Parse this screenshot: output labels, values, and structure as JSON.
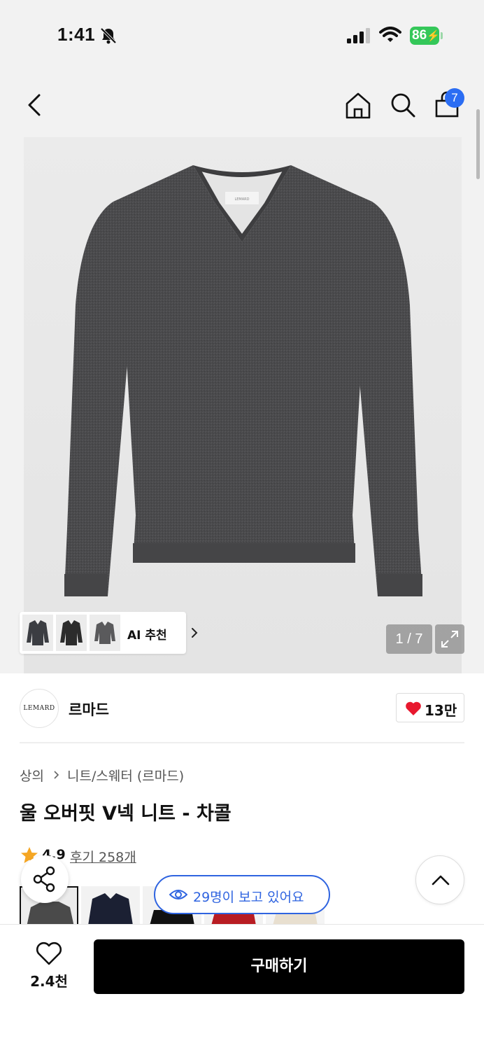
{
  "status_bar": {
    "time": "1:41",
    "battery": "86",
    "icons": [
      "bell-off-icon",
      "signal-icon",
      "wifi-icon",
      "battery-charging-icon"
    ]
  },
  "nav": {
    "icons": [
      "back-icon",
      "home-icon",
      "search-icon",
      "cart-icon"
    ],
    "cart_count": "7"
  },
  "gallery": {
    "counter": "1 / 7",
    "ai_label": "AI 추천",
    "brand_tag": "LEMARD"
  },
  "brand": {
    "logo_text": "LEMARD",
    "name": "르마드",
    "like_count": "13만"
  },
  "product": {
    "breadcrumb": [
      "상의",
      "니트/스웨터 (르마드)"
    ],
    "title": "울 오버핏 V넥 니트 - 차콜",
    "rating": "4.9",
    "reviews": "후기 258개"
  },
  "colors": {
    "swatches": [
      "#4a4a4a",
      "#1b2033",
      "#111111",
      "#b81c22",
      "#e8dfcf"
    ]
  },
  "viewers_text": "29명이 보고 있어요",
  "bottom": {
    "wish_count": "2.4천",
    "buy_label": "구매하기"
  },
  "accent": {
    "blue": "#2f64e0",
    "heart": "#e8182e",
    "star": "#f5a623",
    "battery": "#34c759"
  }
}
